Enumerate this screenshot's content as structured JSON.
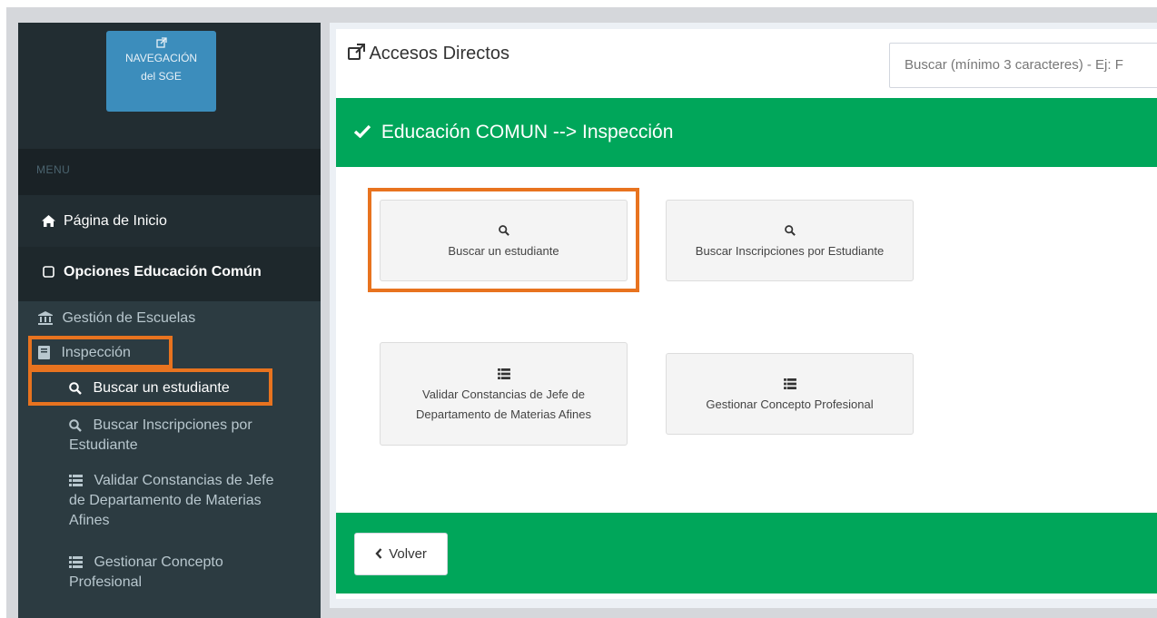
{
  "sidebar": {
    "nav_button": {
      "icon": "external-link-icon",
      "line1": "NAVEGACIÓN",
      "line2": "del SGE"
    },
    "menu_header": "MENU",
    "home": {
      "icon": "home-icon",
      "label": "Página de Inicio"
    },
    "options": {
      "icon": "square-icon",
      "label": "Opciones Educación Común"
    },
    "schools": {
      "icon": "bank-icon",
      "label": "Gestión de Escuelas"
    },
    "inspection": {
      "icon": "book-icon",
      "label": "Inspección"
    },
    "sub_items": [
      {
        "icon": "search-icon",
        "label": "Buscar un estudiante"
      },
      {
        "icon": "search-icon",
        "label_line1": "Buscar Inscripciones por",
        "label_line2": "Estudiante"
      },
      {
        "icon": "list-icon",
        "label_line1": "Validar Constancias de Jefe",
        "label_line2": "de Departamento de Materias",
        "label_line3": "Afines"
      },
      {
        "icon": "list-icon",
        "label_line1": "Gestionar Concepto",
        "label_line2": "Profesional"
      }
    ]
  },
  "main": {
    "title": "Accesos Directos",
    "title_icon": "external-link-icon",
    "search_placeholder": "Buscar (mínimo 3 caracteres) - Ej: F",
    "section_header": "Educación COMUN --> Inspección",
    "section_icon": "check-icon",
    "tiles": [
      {
        "icon": "search-icon",
        "label": "Buscar un estudiante"
      },
      {
        "icon": "search-icon",
        "label": "Buscar Inscripciones por Estudiante"
      },
      {
        "icon": "list-icon",
        "label_line1": "Validar Constancias de Jefe de",
        "label_line2": "Departamento de Materias Afines"
      },
      {
        "icon": "list-icon",
        "label": "Gestionar Concepto Profesional"
      }
    ],
    "back_button": "Volver"
  },
  "colors": {
    "sidebar_bg": "#2c3b41",
    "sidebar_dark": "#222d32",
    "nav_button": "#3c8dbc",
    "green": "#00a65a",
    "highlight": "#e8731f"
  }
}
